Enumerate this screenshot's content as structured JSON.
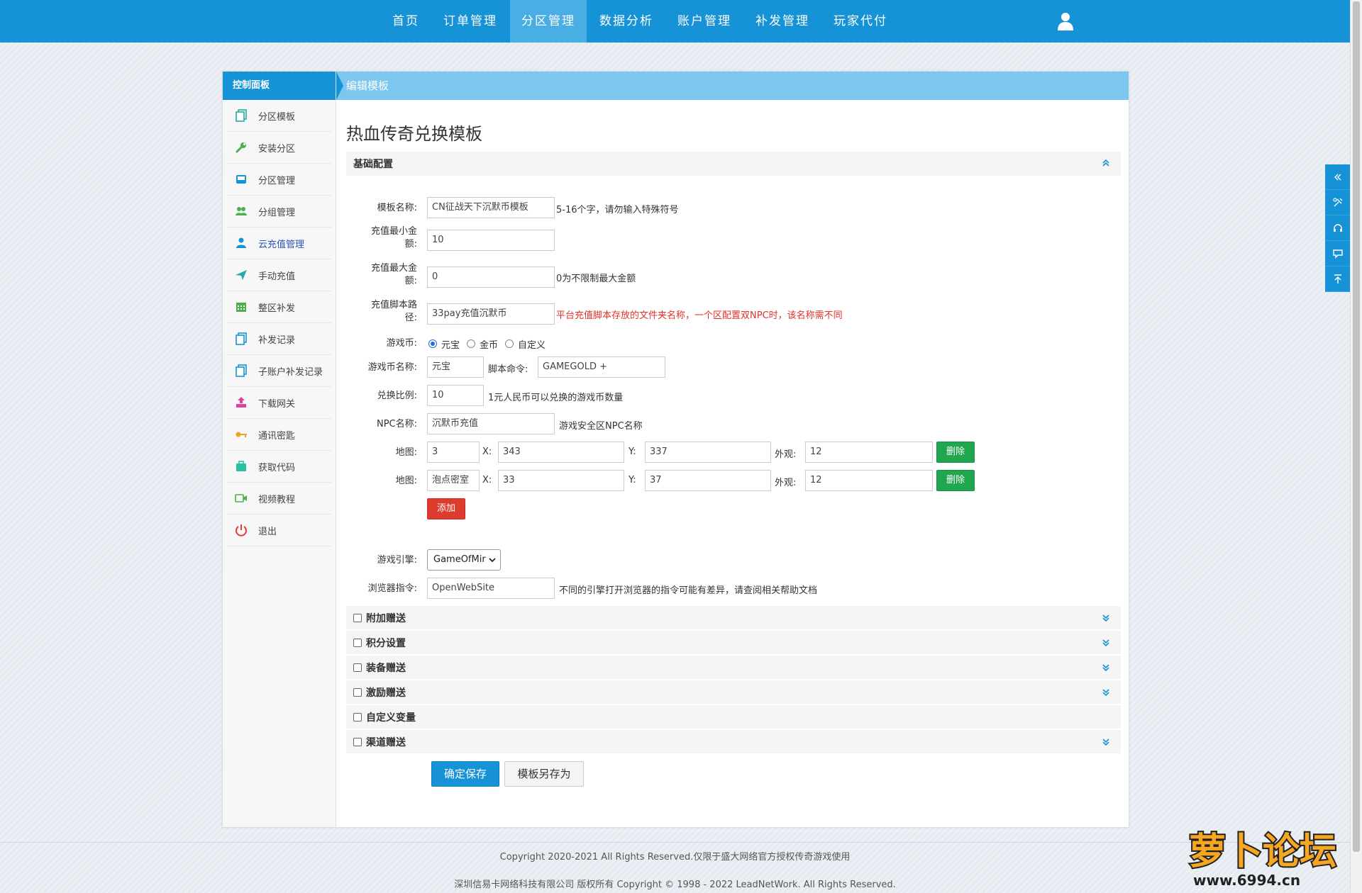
{
  "nav": {
    "items": [
      "首页",
      "订单管理",
      "分区管理",
      "数据分析",
      "账户管理",
      "补发管理",
      "玩家代付"
    ],
    "active_index": 2
  },
  "sidebar": {
    "title": "控制面板",
    "items": [
      {
        "label": "分区模板",
        "icon": "copy-icon",
        "color": "#27a9a3"
      },
      {
        "label": "安装分区",
        "icon": "wrench-icon",
        "color": "#4caf50"
      },
      {
        "label": "分区管理",
        "icon": "inbox-icon",
        "color": "#1593d6"
      },
      {
        "label": "分组管理",
        "icon": "users-icon",
        "color": "#4caf50"
      },
      {
        "label": "云充值管理",
        "icon": "user-cloud-icon",
        "color": "#1593d6",
        "active": true
      },
      {
        "label": "手动充值",
        "icon": "paper-plane-icon",
        "color": "#27a9a3"
      },
      {
        "label": "整区补发",
        "icon": "calendar-icon",
        "color": "#4caf50"
      },
      {
        "label": "补发记录",
        "icon": "copy-icon",
        "color": "#1593d6"
      },
      {
        "label": "子账户补发记录",
        "icon": "copy-icon",
        "color": "#1593d6"
      },
      {
        "label": "下载网关",
        "icon": "download-box-icon",
        "color": "#e040a0"
      },
      {
        "label": "通讯密匙",
        "icon": "key-icon",
        "color": "#f0a030"
      },
      {
        "label": "获取代码",
        "icon": "briefcase-icon",
        "color": "#27c0a0"
      },
      {
        "label": "视频教程",
        "icon": "video-icon",
        "color": "#4caf50"
      },
      {
        "label": "退出",
        "icon": "power-icon",
        "color": "#e53935"
      }
    ]
  },
  "content": {
    "header": "编辑模板",
    "page_title": "热血传奇兑换模板",
    "section_basic": "基础配置"
  },
  "form": {
    "name_label": "模板名称:",
    "name_value": "CN征战天下沉默币模板",
    "name_hint": "5-16个字，请勿输入特殊符号",
    "min_label_1": "充值最小金",
    "min_label_2": "额:",
    "min_value": "10",
    "max_label_1": "充值最大金",
    "max_label_2": "额:",
    "max_value": "0",
    "max_hint": "0为不限制最大金额",
    "script_label_1": "充值脚本路",
    "script_label_2": "径:",
    "script_value": "33pay充值沉默币",
    "script_hint": "平台充值脚本存放的文件夹名称，一个区配置双NPC时，该名称需不同",
    "currency_label": "游戏币:",
    "currency_options": [
      "元宝",
      "金币",
      "自定义"
    ],
    "currency_selected": 0,
    "currency_name_label": "游戏币名称:",
    "currency_name_value": "元宝",
    "script_cmd_label": "脚本命令:",
    "script_cmd_value": "GAMEGOLD +",
    "ratio_label": "兑换比例:",
    "ratio_value": "10",
    "ratio_hint": "1元人民币可以兑换的游戏币数量",
    "npc_label": "NPC名称:",
    "npc_value": "沉默币充值",
    "npc_hint": "游戏安全区NPC名称",
    "map_label": "地图:",
    "x_label": "X:",
    "y_label": "Y:",
    "look_label": "外观:",
    "maps": [
      {
        "map": "3",
        "x": "343",
        "y": "337",
        "look": "12"
      },
      {
        "map": "泡点密室",
        "x": "33",
        "y": "37",
        "look": "12"
      }
    ],
    "delete_label": "删除",
    "add_label": "添加",
    "engine_label": "游戏引擎:",
    "engine_value": "GameOfMir",
    "browser_label": "浏览器指令:",
    "browser_value": "OpenWebSite",
    "browser_hint": "不同的引擎打开浏览器的指令可能有差异，请查阅相关帮助文档"
  },
  "accordions": [
    {
      "label": "附加赠送",
      "chevron": true
    },
    {
      "label": "积分设置",
      "chevron": true
    },
    {
      "label": "装备赠送",
      "chevron": true
    },
    {
      "label": "激励赠送",
      "chevron": true
    },
    {
      "label": "自定义变量",
      "chevron": false
    },
    {
      "label": "渠道赠送",
      "chevron": true
    }
  ],
  "actions": {
    "save": "确定保存",
    "save_as": "模板另存为"
  },
  "footer": {
    "line1": "Copyright 2020-2021 All Rights Reserved.仅限于盛大网络官方授权传奇游戏使用",
    "line2": "深圳信易卡网络科技有限公司 版权所有 Copyright © 1998 - 2022 LeadNetWork. All Rights Reserved."
  },
  "watermark": {
    "text": "萝卜论坛",
    "url": "www.6994.cn"
  },
  "colors": {
    "primary": "#1593d6",
    "header_light": "#7cc6ef",
    "success": "#21a650",
    "danger": "#de3b2f",
    "hint_red": "#e0312a"
  }
}
